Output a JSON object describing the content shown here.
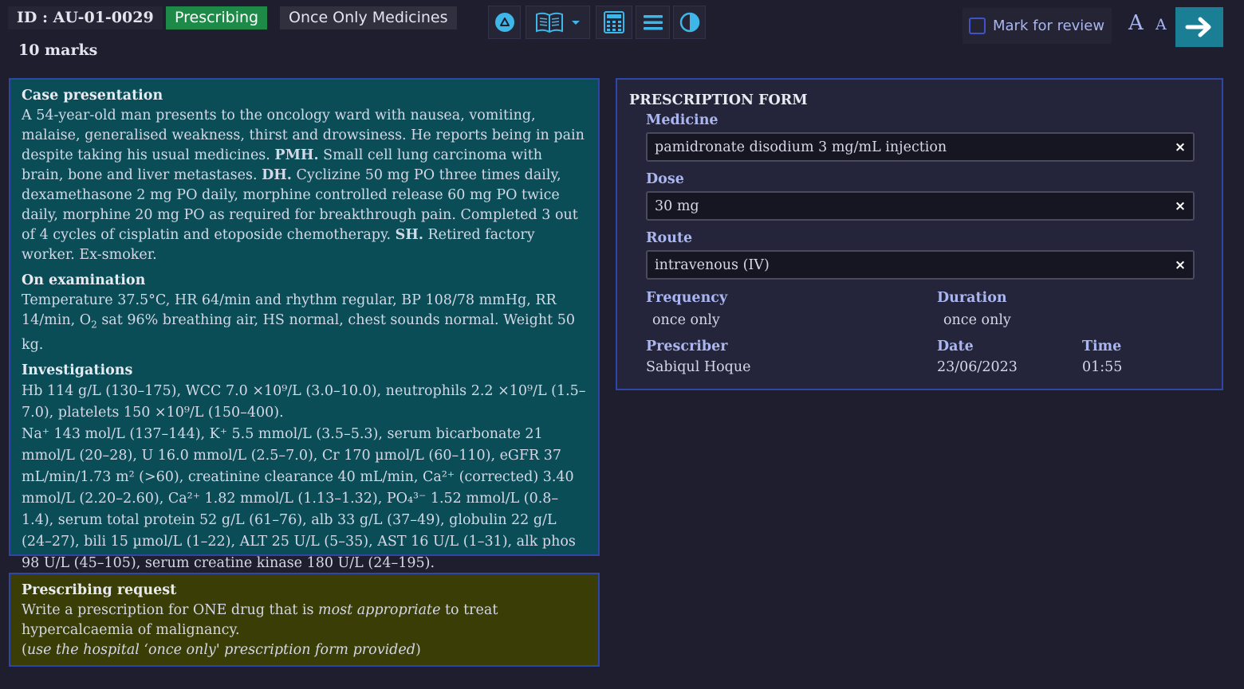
{
  "header": {
    "id": "ID : AU-01-0029",
    "category": "Prescribing",
    "question_type": "Once Only Medicines",
    "marks": "10 marks"
  },
  "toolbar": {
    "icons": [
      "triangle-up-icon",
      "book-icon",
      "calculator-icon",
      "menu-icon",
      "contrast-icon"
    ],
    "mark_for_review": "Mark for review",
    "font_large": "A",
    "font_small": "A"
  },
  "colors": {
    "background": "#1e1e2e",
    "case_panel": "#0a4d57",
    "request_panel": "#3a3d05",
    "prescribing_tag": "#1e8a47",
    "next_button": "#1a7e95",
    "accent_label": "#aab6f0",
    "panel_border": "#2d46a8"
  },
  "case": {
    "presentation_heading": "Case presentation",
    "presentation": {
      "intro": "A 54-year-old man presents to the oncology ward with nausea, vomiting, malaise, generalised weakness, thirst and drowsiness. He reports being in pain despite taking his usual medicines. ",
      "pmh_label": "PMH.",
      "pmh": " Small cell lung carcinoma with brain, bone and liver metastases. ",
      "dh_label": "DH.",
      "dh": " Cyclizine 50 mg PO three times daily, dexamethasone 2 mg PO daily, morphine controlled release 60 mg PO twice daily, morphine 20 mg PO as required for breakthrough pain. Completed 3 out of 4 cycles of cisplatin and etoposide chemotherapy. ",
      "sh_label": "SH.",
      "sh": " Retired factory worker. Ex-smoker."
    },
    "exam_heading": "On examination",
    "exam": {
      "before_sub": "Temperature 37.5°C, HR 64/min and rhythm regular, BP 108/78 mmHg, RR 14/min, O",
      "sub": "2",
      "after_sub": " sat 96% breathing air, HS normal, chest sounds normal. Weight 50 kg."
    },
    "investigations_heading": "Investigations",
    "investigations": [
      "Hb 114 g/L (130–175), WCC 7.0 ×10⁹/L (3.0–10.0), neutrophils 2.2 ×10⁹/L (1.5–7.0), platelets 150 ×10⁹/L (150–400).",
      "Na⁺ 143 mol/L (137–144), K⁺ 5.5 mmol/L (3.5–5.3), serum bicarbonate 21 mmol/L (20–28), U 16.0 mmol/L (2.5–7.0), Cr 170 µmol/L (60–110), eGFR 37 mL/min/1.73 m² (>60), creatinine clearance 40 mL/min, Ca²⁺ (corrected) 3.40 mmol/L (2.20–2.60), Ca²⁺ 1.82 mmol/L (1.13–1.32), PO₄³⁻ 1.52 mmol/L (0.8–1.4), serum total protein 52 g/L (61–76), alb 33 g/L (37–49), globulin 22 g/L (24–27), bili 15 µmol/L (1–22), ALT 25 U/L (5–35), AST 16 U/L (1–31), alk phos 98 U/L (45–105), serum creatine kinase 180 U/L (24–195)."
    ]
  },
  "request": {
    "heading": "Prescribing request",
    "line1_a": "Write a prescription for ONE drug that is ",
    "line1_em": "most appropriate",
    "line1_b": " to treat hypercalcaemia of malignancy.",
    "line2_open": "(",
    "line2_em": "use the hospital ‘once only' prescription form provided",
    "line2_close": ")"
  },
  "form": {
    "title": "PRESCRIPTION FORM",
    "medicine_label": "Medicine",
    "medicine_value": "pamidronate disodium 3 mg/mL injection",
    "dose_label": "Dose",
    "dose_value": "30 mg",
    "route_label": "Route",
    "route_value": "intravenous (IV)",
    "clear_symbol": "×",
    "frequency_label": "Frequency",
    "frequency_value": "once only",
    "duration_label": "Duration",
    "duration_value": "once only",
    "prescriber_label": "Prescriber",
    "prescriber_value": "Sabiqul Hoque",
    "date_label": "Date",
    "date_value": "23/06/2023",
    "time_label": "Time",
    "time_value": "01:55"
  }
}
